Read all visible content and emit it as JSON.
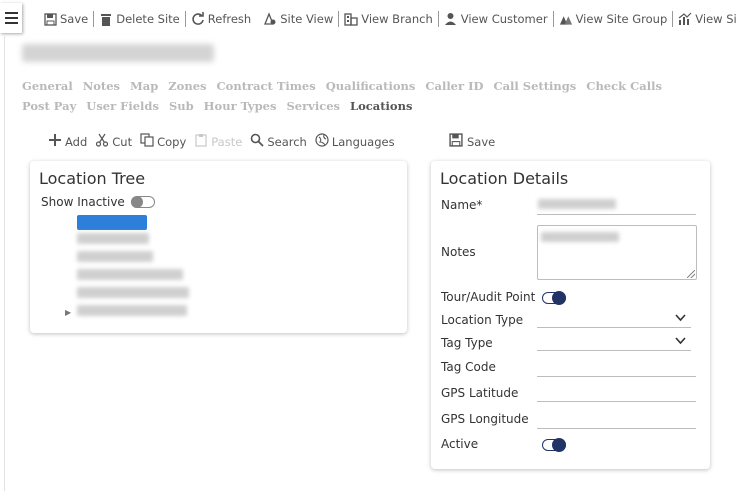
{
  "toolbar": {
    "items": [
      {
        "label": "Save",
        "icon": "save-icon"
      },
      {
        "label": "Delete Site",
        "icon": "trash-icon"
      },
      {
        "label": "Refresh",
        "icon": "refresh-icon"
      },
      {
        "label": "Site View",
        "icon": "site-view-icon"
      },
      {
        "label": "View Branch",
        "icon": "building-icon"
      },
      {
        "label": "View Customer",
        "icon": "customer-icon"
      },
      {
        "label": "View Site Group",
        "icon": "site-group-icon"
      },
      {
        "label": "View Site",
        "icon": "chart-icon"
      }
    ]
  },
  "tabs": [
    "General",
    "Notes",
    "Map",
    "Zones",
    "Contract Times",
    "Qualifications",
    "Caller ID",
    "Call Settings",
    "Check Calls",
    "Post Pay",
    "User Fields",
    "Sub",
    "Hour Types",
    "Services",
    "Locations"
  ],
  "active_tab": "Locations",
  "actions": {
    "add": "Add",
    "cut": "Cut",
    "copy": "Copy",
    "paste": "Paste",
    "search": "Search",
    "languages": "Languages",
    "save": "Save"
  },
  "tree": {
    "title": "Location Tree",
    "show_inactive_label": "Show Inactive",
    "show_inactive": false
  },
  "details": {
    "title": "Location Details",
    "name_label": "Name*",
    "notes_label": "Notes",
    "tour_label": "Tour/Audit Point",
    "tour_on": true,
    "location_type_label": "Location Type",
    "tag_type_label": "Tag Type",
    "tag_code_label": "Tag Code",
    "gps_lat_label": "GPS Latitude",
    "gps_long_label": "GPS Longitude",
    "active_label": "Active",
    "active_on": true
  },
  "colors": {
    "accent": "#223366",
    "selection": "#2e7fd9",
    "tab_inactive": "#b9b9b9"
  }
}
